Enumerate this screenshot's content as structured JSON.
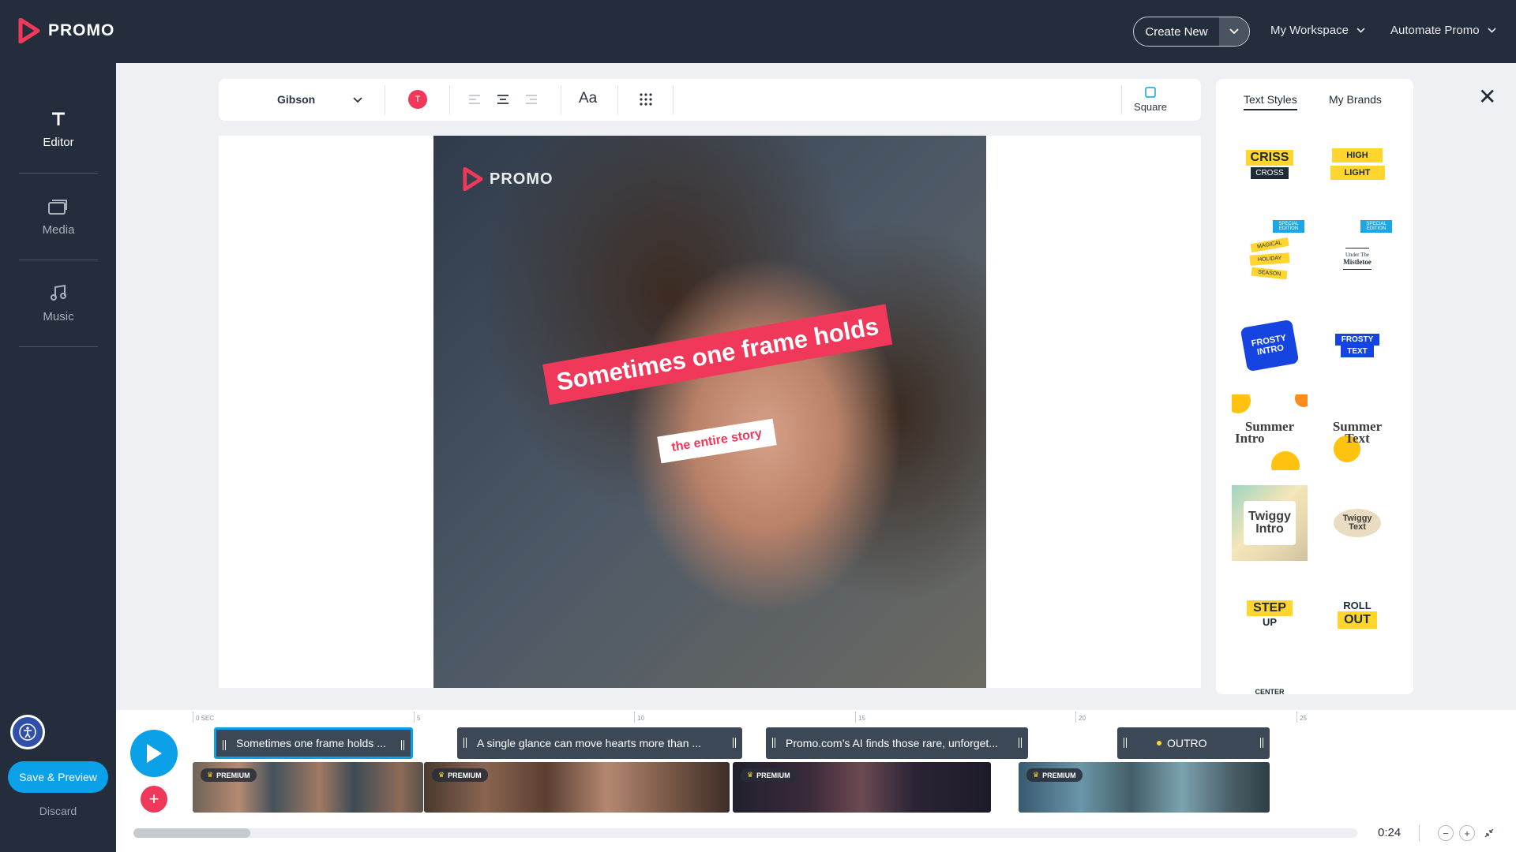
{
  "app": {
    "logo_text": "PROMO"
  },
  "header": {
    "create_new": "Create New",
    "nav": [
      {
        "label": "My Workspace"
      },
      {
        "label": "Automate Promo"
      }
    ]
  },
  "sidebar": {
    "items": [
      {
        "label": "Editor",
        "icon": "text-t-icon",
        "active": true
      },
      {
        "label": "Media",
        "icon": "media-stack-icon",
        "active": false
      },
      {
        "label": "Music",
        "icon": "music-note-icon",
        "active": false
      }
    ],
    "save_preview": "Save & Preview",
    "discard": "Discard"
  },
  "toolbar": {
    "font": "Gibson",
    "color_swatch_label": "T",
    "color": "#f0385b",
    "case_label": "Aa",
    "aspect_label": "Square"
  },
  "canvas": {
    "watermark": "PROMO",
    "caption_main": "Sometimes one frame holds",
    "caption_sub": "the entire story"
  },
  "right_panel": {
    "tabs": [
      {
        "label": "Text Styles",
        "active": true
      },
      {
        "label": "My Brands",
        "active": false
      }
    ],
    "styles": [
      {
        "line1": "CRISS",
        "line2": "CROSS"
      },
      {
        "line1": "HIGH",
        "line2": "LIGHT"
      },
      {
        "line1": "MAGICAL",
        "line2": "HOLIDAY",
        "line3": "SEASON",
        "badge": "SPECIAL EDITION"
      },
      {
        "line1": "Under The",
        "line2": "Mistletoe",
        "badge": "SPECIAL EDITION"
      },
      {
        "line1": "FROSTY",
        "line2": "INTRO"
      },
      {
        "line1": "FROSTY",
        "line2": "TEXT"
      },
      {
        "line1": "Summer",
        "line2": "Intro"
      },
      {
        "line1": "Summer",
        "line2": "Text"
      },
      {
        "line1": "Twiggy",
        "line2": "Intro"
      },
      {
        "line1": "Twiggy",
        "line2": "Text"
      },
      {
        "line1": "STEP",
        "line2": "UP"
      },
      {
        "line1": "ROLL",
        "line2": "OUT"
      },
      {
        "line1": "CENTER"
      }
    ]
  },
  "timeline": {
    "ruler": [
      "0 SEC",
      "5",
      "10",
      "15",
      "20",
      "25"
    ],
    "text_clips": [
      {
        "label": "Sometimes one frame holds ..."
      },
      {
        "label": "A single glance can move hearts more than ..."
      },
      {
        "label": "Promo.com’s AI finds those rare, unforget..."
      },
      {
        "label": "OUTRO"
      }
    ],
    "premium_label": "PREMIUM",
    "time": "0:24",
    "scroll_position": 0.0
  },
  "colors": {
    "brand_pink": "#f0385b",
    "accent_blue": "#0aa1e8",
    "navy": "#232d3b"
  }
}
